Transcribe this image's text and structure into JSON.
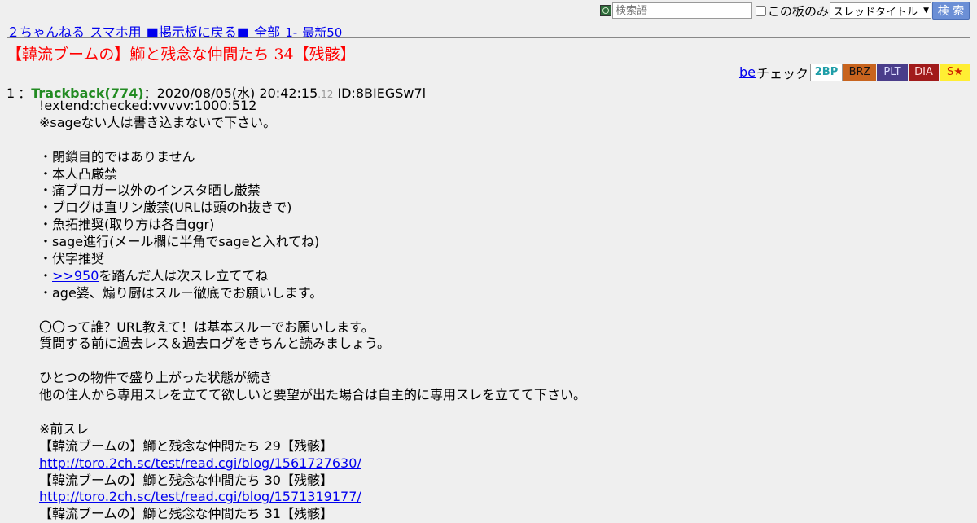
{
  "search": {
    "placeholder": "検索語",
    "board_only_label": "この板のみ",
    "select_value": "スレッドタイトル",
    "button_label": "検 索"
  },
  "nav": {
    "items": [
      "２ちゃんねる",
      "スマホ用",
      "■掲示板に戻る■",
      "全部",
      "1-",
      "最新50"
    ]
  },
  "thread_title": "【韓流ブームの】鰤と残念な仲間たち 34【残骸】",
  "be": {
    "link": "be",
    "text": "チェック",
    "badges": [
      "2BP",
      "BRZ",
      "PLT",
      "DIA",
      "S★"
    ]
  },
  "post": {
    "number": "1",
    "separator": "：",
    "name": "Trackback(774)",
    "colon": "：",
    "datetime": "2020/08/05(水) 20:42:15",
    "ms": ".12",
    "id": "ID:8BIEGSw7l",
    "lines": [
      {
        "text": "!extend:checked:vvvvv:1000:512"
      },
      {
        "text": "※sageない人は書き込まないで下さい。"
      },
      {
        "text": ""
      },
      {
        "text": "・閉鎖目的ではありません"
      },
      {
        "text": "・本人凸厳禁"
      },
      {
        "text": "・痛ブロガー以外のインスタ晒し厳禁"
      },
      {
        "text": "・ブログは直リン厳禁(URLは頭のh抜きで)"
      },
      {
        "text": "・魚拓推奨(取り方は各自ggr)"
      },
      {
        "text": "・sage進行(メール欄に半角でsageと入れてね)"
      },
      {
        "text": "・伏字推奨"
      },
      {
        "prefix": "・",
        "link": ">>950",
        "suffix": "を踏んだ人は次スレ立ててね"
      },
      {
        "text": "・age婆、煽り厨はスルー徹底でお願いします。"
      },
      {
        "text": ""
      },
      {
        "text": "〇〇って誰？URL教えて！は基本スルーでお願いします。"
      },
      {
        "text": "質問する前に過去レス＆過去ログをきちんと読みましょう。"
      },
      {
        "text": ""
      },
      {
        "text": "ひとつの物件で盛り上がった状態が続き"
      },
      {
        "text": "他の住人から専用スレを立てて欲しいと要望が出た場合は自主的に専用スレを立てて下さい。"
      },
      {
        "text": ""
      },
      {
        "text": "※前スレ"
      },
      {
        "text": "【韓流ブームの】鰤と残念な仲間たち 29【残骸】"
      },
      {
        "link": "http://toro.2ch.sc/test/read.cgi/blog/1561727630/"
      },
      {
        "text": "【韓流ブームの】鰤と残念な仲間たち 30【残骸】"
      },
      {
        "link": "http://toro.2ch.sc/test/read.cgi/blog/1571319177/"
      },
      {
        "text": "【韓流ブームの】鰤と残念な仲間たち 31【残骸】"
      }
    ]
  }
}
